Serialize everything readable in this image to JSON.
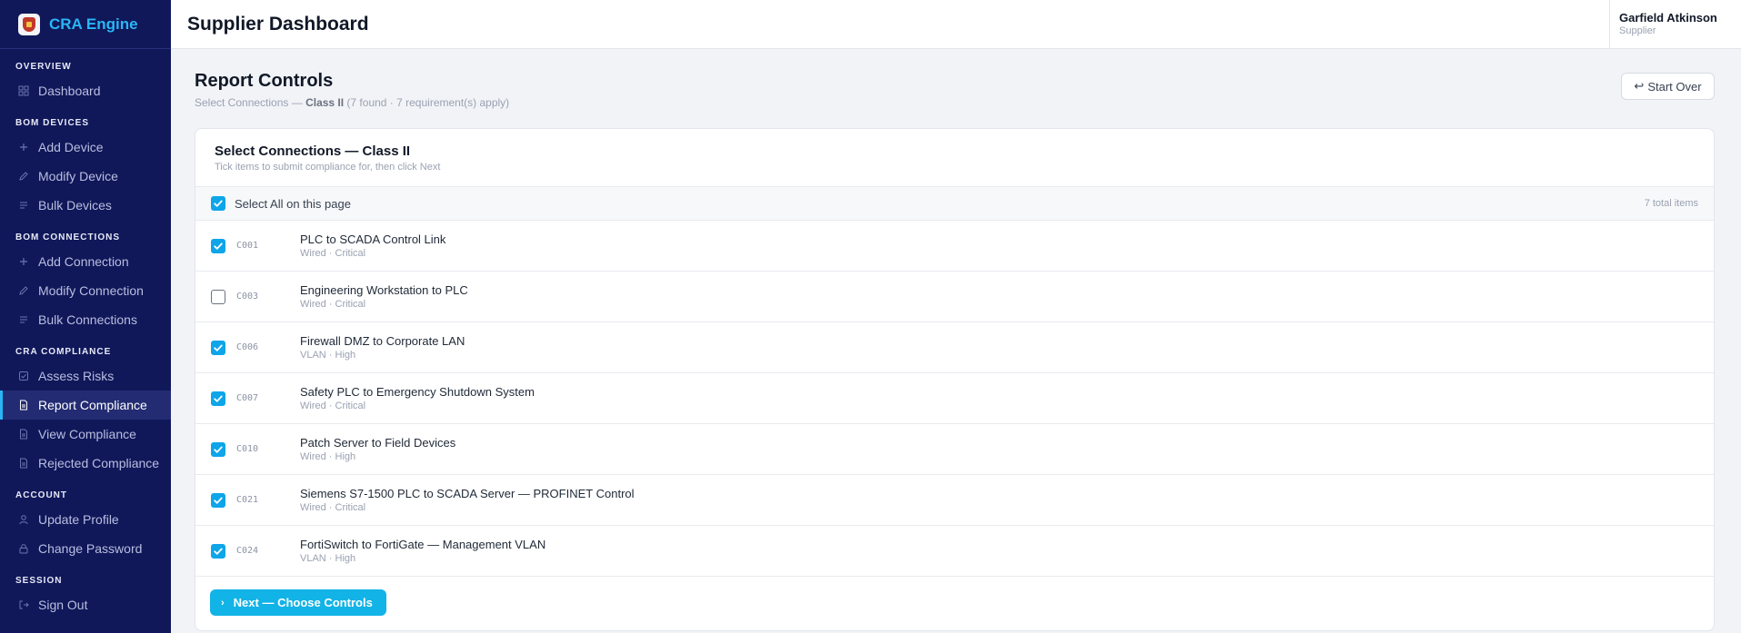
{
  "brand": {
    "name": "CRA Engine",
    "logo_icon": "shield-lock-icon"
  },
  "topbar": {
    "title": "Supplier Dashboard"
  },
  "user": {
    "name": "Garfield Atkinson",
    "role": "Supplier"
  },
  "sidebar": {
    "sections": [
      {
        "title": "OVERVIEW",
        "items": [
          {
            "label": "Dashboard",
            "icon": "grid-icon"
          }
        ]
      },
      {
        "title": "BOM DEVICES",
        "items": [
          {
            "label": "Add Device",
            "icon": "plus-icon"
          },
          {
            "label": "Modify Device",
            "icon": "pencil-icon"
          },
          {
            "label": "Bulk Devices",
            "icon": "list-icon"
          }
        ]
      },
      {
        "title": "BOM CONNECTIONS",
        "items": [
          {
            "label": "Add Connection",
            "icon": "plus-icon"
          },
          {
            "label": "Modify Connection",
            "icon": "pencil-icon"
          },
          {
            "label": "Bulk Connections",
            "icon": "list-icon"
          }
        ]
      },
      {
        "title": "CRA COMPLIANCE",
        "items": [
          {
            "label": "Assess Risks",
            "icon": "checkbox-icon"
          },
          {
            "label": "Report Compliance",
            "icon": "document-icon",
            "active": true
          },
          {
            "label": "View Compliance",
            "icon": "document-icon"
          },
          {
            "label": "Rejected Compliance",
            "icon": "document-icon"
          }
        ]
      },
      {
        "title": "ACCOUNT",
        "items": [
          {
            "label": "Update Profile",
            "icon": "user-icon"
          },
          {
            "label": "Change Password",
            "icon": "lock-icon"
          }
        ]
      },
      {
        "title": "SESSION",
        "items": [
          {
            "label": "Sign Out",
            "icon": "logout-icon"
          }
        ]
      }
    ]
  },
  "page": {
    "title": "Report Controls",
    "subtitle_prefix": "Select Connections — ",
    "subtitle_class": "Class II",
    "subtitle_suffix": " (7 found · 7 requirement(s) apply)",
    "start_over_label": "Start Over",
    "start_over_icon": "undo-arrow-icon"
  },
  "card": {
    "title": "Select Connections — Class II",
    "subtitle": "Tick items to submit compliance for, then click Next",
    "select_all_label": "Select All on this page",
    "select_all_checked": true,
    "total_items": "7 total items",
    "next_label": "Next — Choose Controls",
    "next_icon": "chevron-right-icon"
  },
  "connections": [
    {
      "id": "C001",
      "name": "PLC to SCADA Control Link",
      "meta": "Wired · Critical",
      "checked": true
    },
    {
      "id": "C003",
      "name": "Engineering Workstation to PLC",
      "meta": "Wired · Critical",
      "checked": false
    },
    {
      "id": "C006",
      "name": "Firewall DMZ to Corporate LAN",
      "meta": "VLAN · High",
      "checked": true
    },
    {
      "id": "C007",
      "name": "Safety PLC to Emergency Shutdown System",
      "meta": "Wired · Critical",
      "checked": true
    },
    {
      "id": "C010",
      "name": "Patch Server to Field Devices",
      "meta": "Wired · High",
      "checked": true
    },
    {
      "id": "C021",
      "name": "Siemens S7-1500 PLC to SCADA Server — PROFINET Control",
      "meta": "Wired · Critical",
      "checked": true
    },
    {
      "id": "C024",
      "name": "FortiSwitch to FortiGate — Management VLAN",
      "meta": "VLAN · High",
      "checked": true
    }
  ],
  "colors": {
    "sidebar_bg": "#10185a",
    "accent": "#0ea5e9",
    "brand_text": "#29b6f6"
  }
}
